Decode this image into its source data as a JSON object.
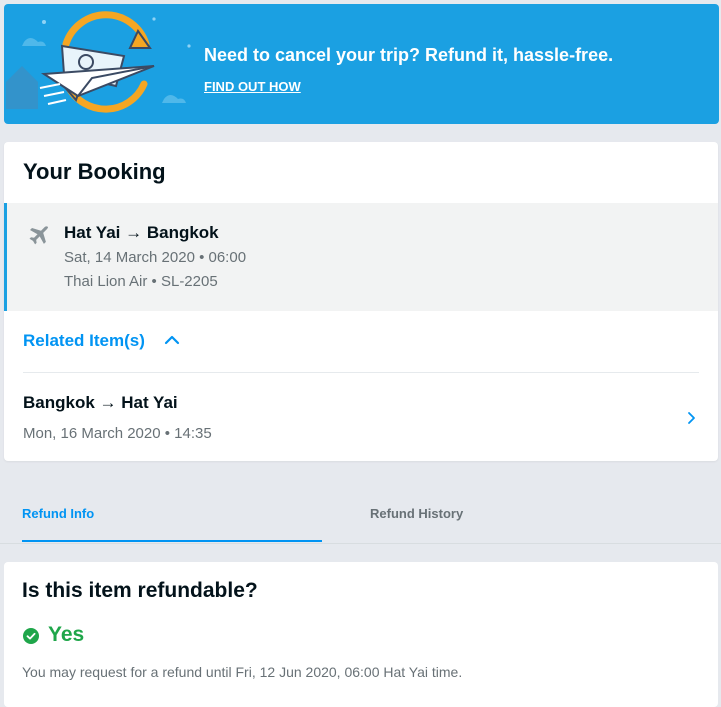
{
  "banner": {
    "title": "Need to cancel your trip? Refund it, hassle-free.",
    "link": "FIND OUT HOW",
    "illustration": "refund-plane-illustration-icon"
  },
  "booking": {
    "title": "Your Booking",
    "item": {
      "icon": "plane-icon",
      "route": "Hat Yai → Bangkok",
      "datetime": "Sat, 14 March 2020 • 06:00",
      "flight": "Thai Lion Air • SL-2205"
    },
    "related_label": "Related Item(s)",
    "related": [
      {
        "route": "Bangkok → Hat Yai",
        "datetime": "Mon, 16 March 2020 • 14:35"
      }
    ]
  },
  "tabs": [
    {
      "label": "Refund Info",
      "active": true
    },
    {
      "label": "Refund History",
      "active": false
    }
  ],
  "refund": {
    "question": "Is this item refundable?",
    "answer": "Yes",
    "note": "You may request for a refund until Fri, 12 Jun 2020, 06:00 Hat Yai time."
  },
  "colors": {
    "banner": "#1ba0e2",
    "accent": "#0194f3",
    "success": "#1fa64a",
    "muted": "#687176"
  }
}
